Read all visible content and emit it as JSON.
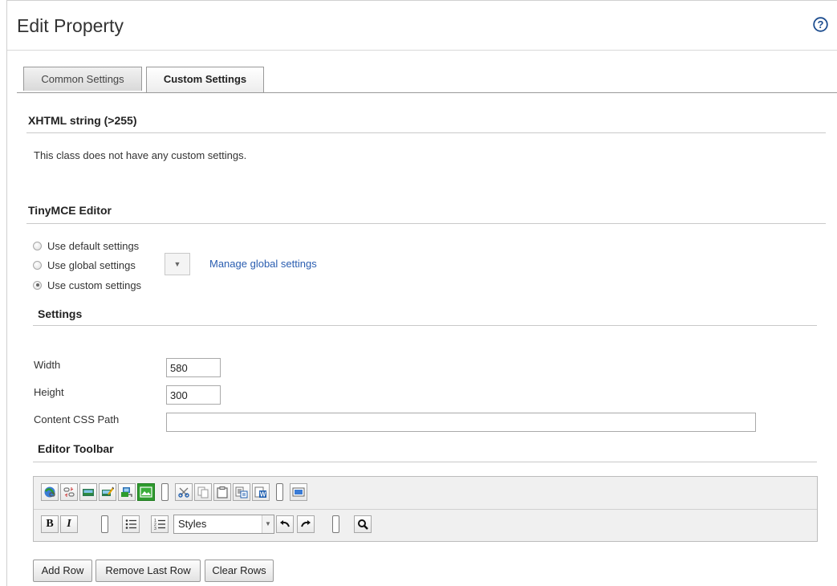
{
  "page": {
    "title": "Edit Property",
    "help_label": "?"
  },
  "tabs": [
    {
      "label": "Common Settings",
      "active": false
    },
    {
      "label": "Custom Settings",
      "active": true
    }
  ],
  "xhtml_section": {
    "heading": "XHTML string (>255)",
    "message": "This class does not have any custom settings."
  },
  "tinymce_section": {
    "heading": "TinyMCE Editor",
    "options": [
      {
        "label": "Use default settings",
        "checked": false
      },
      {
        "label": "Use global settings",
        "checked": false
      },
      {
        "label": "Use custom settings",
        "checked": true
      }
    ],
    "global_select_value": "",
    "manage_link": "Manage global settings"
  },
  "settings_section": {
    "heading": "Settings",
    "width_label": "Width",
    "width_value": "580",
    "height_label": "Height",
    "height_value": "300",
    "css_label": "Content CSS Path",
    "css_value": ""
  },
  "toolbar_section": {
    "heading": "Editor Toolbar",
    "row1": [
      "insert-link-icon",
      "unlink-icon",
      "insert-image-icon",
      "edit-image-icon",
      "insert-media-icon",
      "image-gallery-icon",
      "separator",
      "cut-icon",
      "copy-icon",
      "paste-icon",
      "paste-text-icon",
      "paste-word-icon",
      "separator",
      "fullscreen-icon"
    ],
    "row2": [
      "bold-icon",
      "italic-icon",
      "separator",
      "bullet-list-icon",
      "numbered-list-icon",
      "styles-select",
      "undo-icon",
      "redo-icon",
      "separator",
      "search-icon"
    ],
    "bold_label": "B",
    "italic_label": "I",
    "styles_label": "Styles"
  },
  "buttons": {
    "add_row": "Add Row",
    "remove_last_row": "Remove Last Row",
    "clear_rows": "Clear Rows"
  },
  "colors": {
    "link": "#2a5db0",
    "accent_green": "#2e9b2e",
    "accent_blue": "#1f5fb0"
  }
}
